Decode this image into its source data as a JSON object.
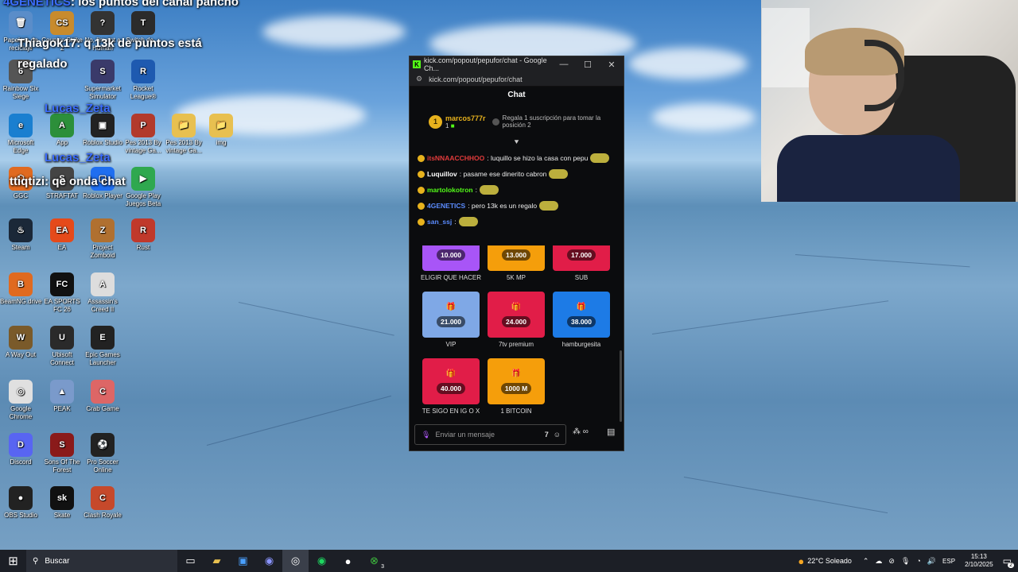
{
  "overlay_chat": [
    {
      "nick": "4GENETICS",
      "text": ": los puntos del canal pancho"
    },
    {
      "nick": "",
      "text": "Thiagok17: q 13k de puntos está"
    },
    {
      "nick": "",
      "text": "regalado"
    },
    {
      "nick": "Lucas_Zeta",
      "text": ""
    },
    {
      "nick": "Lucas_Zeta",
      "text": ""
    },
    {
      "nick": "",
      "text": "ttiqtizi: qe onda chat"
    }
  ],
  "desktop_icons": [
    {
      "label": "Papelera de reciclaje",
      "glyph": "🗑",
      "color": "#5a8dc9"
    },
    {
      "label": "Counter-Strike 2",
      "glyph": "CS",
      "color": "#c88b2d"
    },
    {
      "label": "No, I'm not a Human",
      "glyph": "?",
      "color": "#333"
    },
    {
      "label": "Switch de ...",
      "glyph": "T",
      "color": "#2b2b2b"
    },
    {
      "label": "Rainbow Six Siege",
      "glyph": "6",
      "color": "#555"
    },
    {
      "label": "Supermarket Simulator",
      "glyph": "S",
      "color": "#3a3a6a"
    },
    {
      "label": "Rocket League®",
      "glyph": "R",
      "color": "#1e5ab0"
    },
    {
      "label": "Microsoft Edge",
      "glyph": "e",
      "color": "#1a7fd0"
    },
    {
      "label": "App",
      "glyph": "A",
      "color": "#2c8f3a"
    },
    {
      "label": "Roblox Studio",
      "glyph": "▣",
      "color": "#222"
    },
    {
      "label": "Pes 2013 By vintage Ga...",
      "glyph": "P",
      "color": "#b23a2c"
    },
    {
      "label": "Pes 2013 By vintage Ga...",
      "glyph": "📁",
      "color": "#e8c050"
    },
    {
      "label": "img",
      "glyph": "📁",
      "color": "#e8c050"
    },
    {
      "label": "GGC",
      "glyph": "⬡",
      "color": "#e06a20"
    },
    {
      "label": "STRAFTAT",
      "glyph": "S",
      "color": "#444"
    },
    {
      "label": "Roblox Player",
      "glyph": "▢",
      "color": "#1f6ef0"
    },
    {
      "label": "Google Play Juegos Beta",
      "glyph": "▶",
      "color": "#2fa84f"
    },
    {
      "label": "Steam",
      "glyph": "♨",
      "color": "#1b2838"
    },
    {
      "label": "EA",
      "glyph": "EA",
      "color": "#e54a1a"
    },
    {
      "label": "Project Zomboid",
      "glyph": "Z",
      "color": "#b07030"
    },
    {
      "label": "Rust",
      "glyph": "R",
      "color": "#c0392b"
    },
    {
      "label": "BeamNG.drive",
      "glyph": "B",
      "color": "#e06a20"
    },
    {
      "label": "EA SPORTS FC 26",
      "glyph": "FC",
      "color": "#111"
    },
    {
      "label": "Assassin's Creed II",
      "glyph": "A",
      "color": "#ddd"
    },
    {
      "label": "A Way Out",
      "glyph": "W",
      "color": "#7a5a2a"
    },
    {
      "label": "Ubisoft Connect",
      "glyph": "U",
      "color": "#2a2a2a"
    },
    {
      "label": "Epic Games Launcher",
      "glyph": "E",
      "color": "#222"
    },
    {
      "label": "Google Chrome",
      "glyph": "◎",
      "color": "#e0e0e0"
    },
    {
      "label": "PEAK",
      "glyph": "▲",
      "color": "#7a9acb"
    },
    {
      "label": "Crab Game",
      "glyph": "C",
      "color": "#d66"
    },
    {
      "label": "Discord",
      "glyph": "D",
      "color": "#5865f2"
    },
    {
      "label": "Sons Of The Forest",
      "glyph": "S",
      "color": "#8a1a1a"
    },
    {
      "label": "Pro Soccer Online",
      "glyph": "⚽",
      "color": "#222"
    },
    {
      "label": "OBS Studio",
      "glyph": "●",
      "color": "#222"
    },
    {
      "label": "Skate",
      "glyph": "sk",
      "color": "#111"
    },
    {
      "label": "Clash Royale",
      "glyph": "C",
      "color": "#c6492b"
    }
  ],
  "window": {
    "title": "kick.com/popout/pepufor/chat - Google Ch...",
    "url": "kick.com/popout/pepufor/chat",
    "minimize": "—",
    "maximize": "☐",
    "close": "✕"
  },
  "chat": {
    "header": "Chat",
    "pinned_user": "marcos777r",
    "pinned_rank": "1",
    "pinned_count": "1",
    "pinned_info": "Regala 1 suscripción para tomar la posición 2",
    "messages": [
      {
        "user": "itsNNAACCHHOO",
        "user_color": "#e23b3b",
        "text": ": luquillo se hizo la casa con pepu"
      },
      {
        "user": "Luquillov",
        "user_color": "#ffffff",
        "text": ": pasame ese dinerito cabron"
      },
      {
        "user": "martolokotron",
        "user_color": "#53fc18",
        "text": ":"
      },
      {
        "user": "4GENETICS",
        "user_color": "#5b8cff",
        "text": ": pero 13k es un regalo"
      },
      {
        "user": "san_ssj",
        "user_color": "#5b8cff",
        "text": ":"
      }
    ],
    "input_placeholder": "Enviar un mensaje"
  },
  "rewards": [
    {
      "price": "10.000",
      "label": "ELIGIR QUE HACER",
      "color": "#a855f7"
    },
    {
      "price": "13.000",
      "label": "5K MP",
      "color": "#f59e0b"
    },
    {
      "price": "17.000",
      "label": "SUB",
      "color": "#e11d48"
    },
    {
      "price": "21.000",
      "label": "VIP",
      "color": "#7fa8e6"
    },
    {
      "price": "24.000",
      "label": "7tv premium",
      "color": "#e11d48"
    },
    {
      "price": "38.000",
      "label": "hamburgesita",
      "color": "#1d7be6"
    },
    {
      "price": "40.000",
      "label": "TE SIGO EN IG O X",
      "color": "#e11d48"
    },
    {
      "price": "1000 M",
      "label": "1 BITCOIN",
      "color": "#f59e0b"
    }
  ],
  "taskbar": {
    "search": "Buscar",
    "weather": "22°C Soleado",
    "lang": "ESP",
    "time": "15:13",
    "date": "2/10/2025",
    "xbox_badge": "3",
    "notif": "2"
  }
}
